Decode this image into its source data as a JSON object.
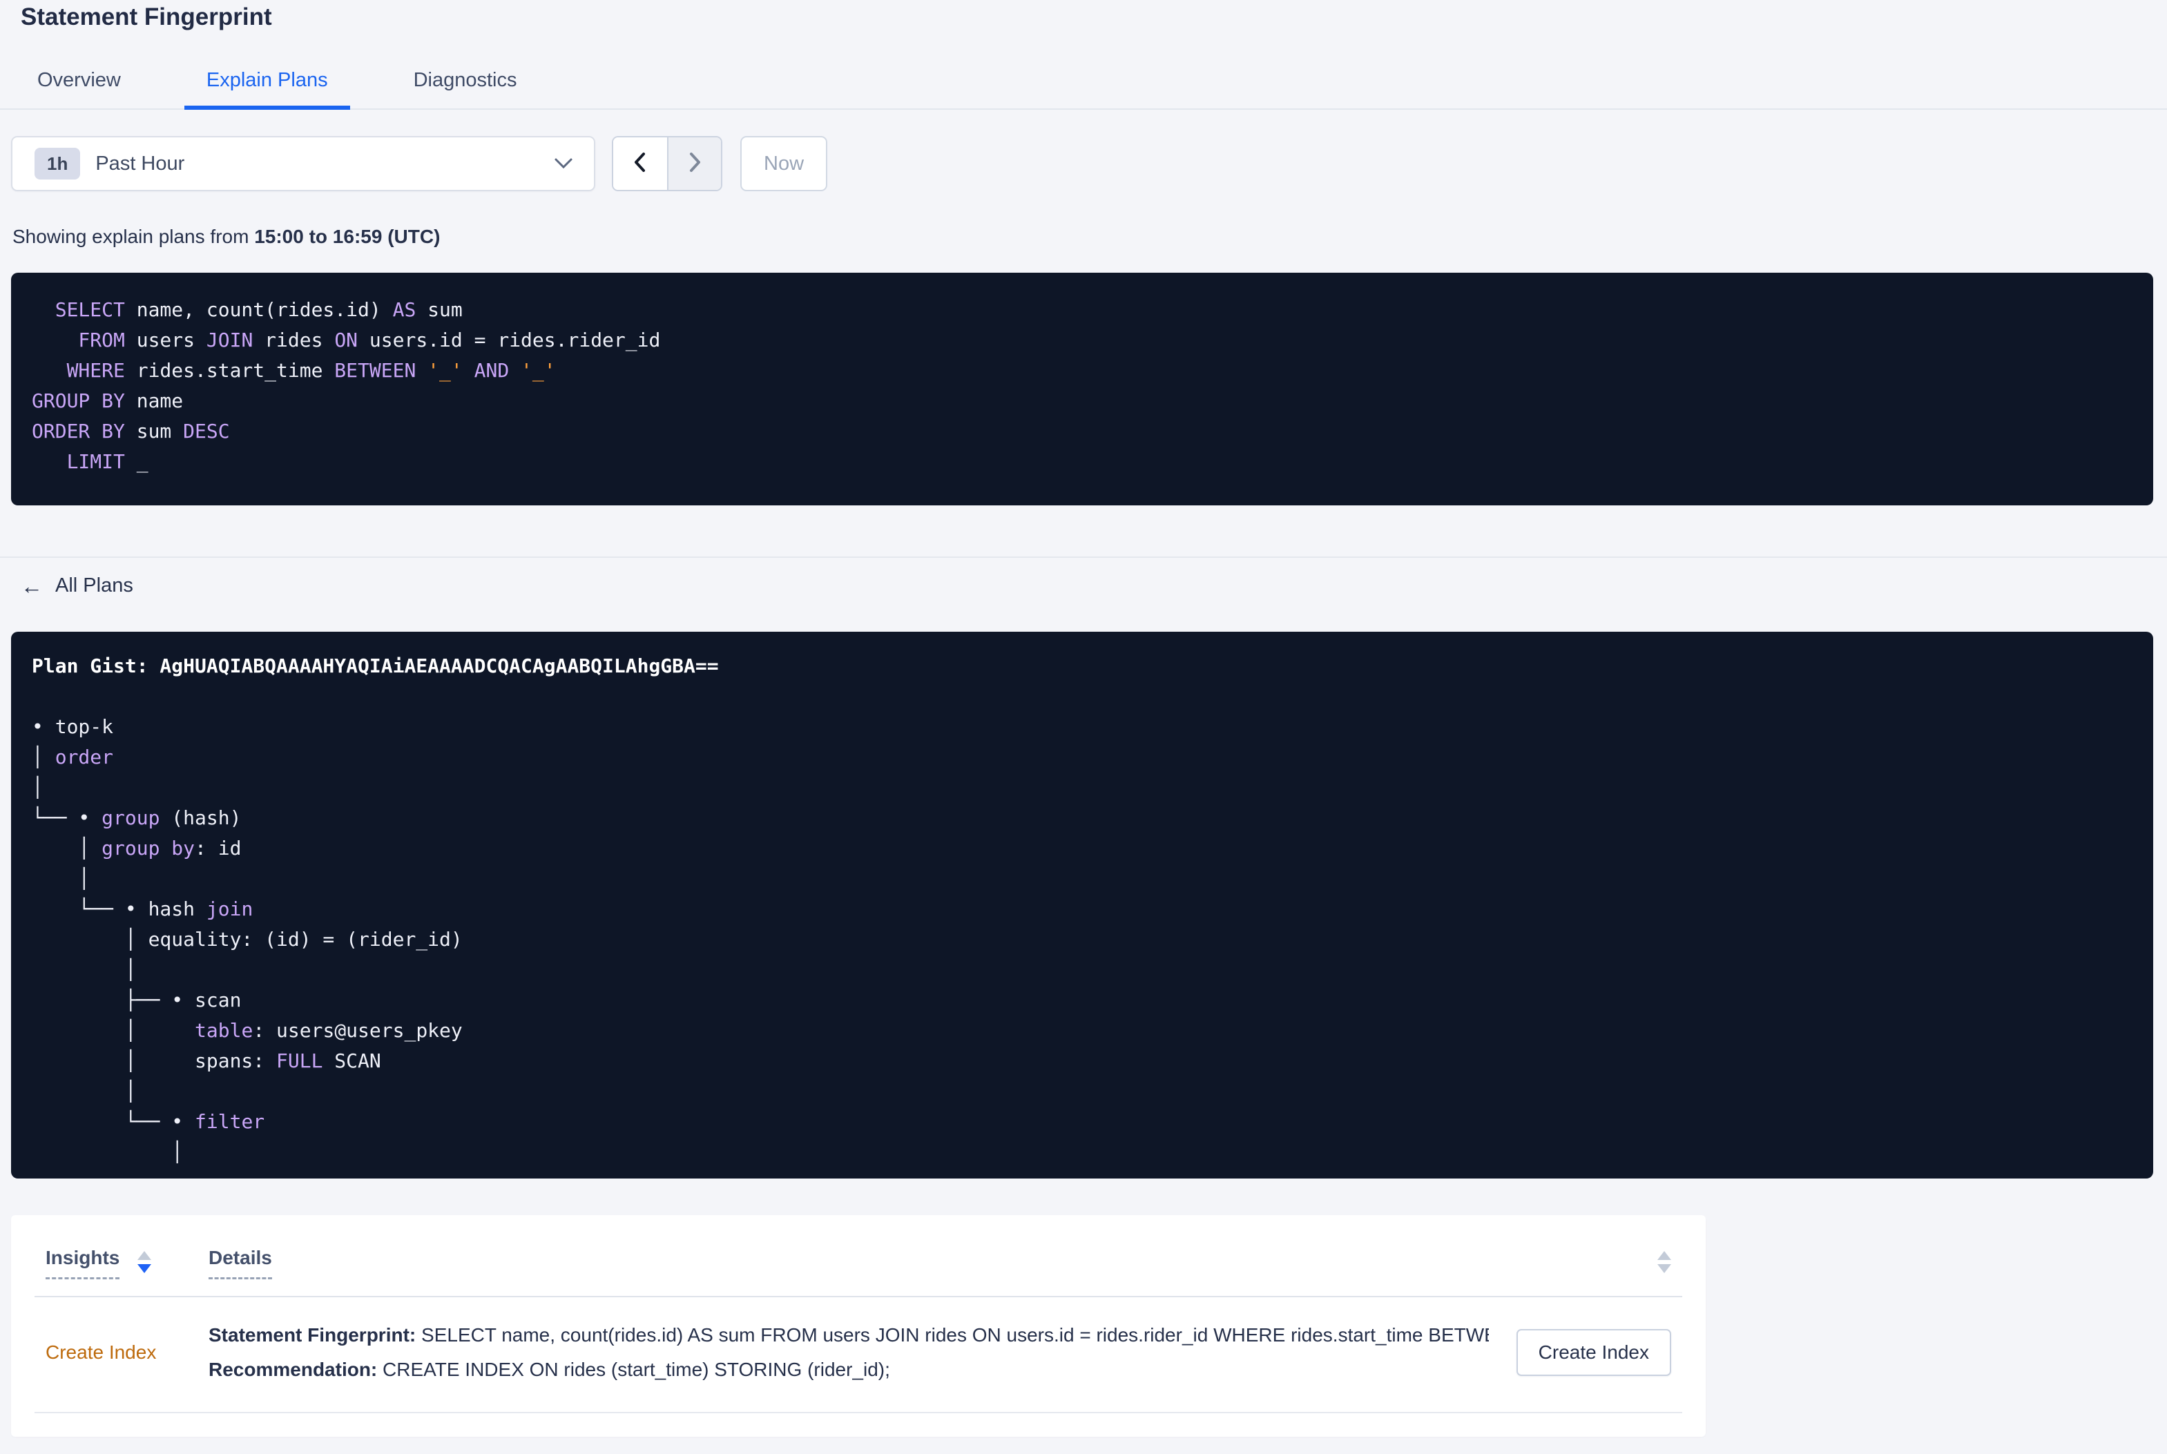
{
  "page": {
    "title": "Statement Fingerprint"
  },
  "tabs": [
    {
      "label": "Overview",
      "active": false
    },
    {
      "label": "Explain Plans",
      "active": true
    },
    {
      "label": "Diagnostics",
      "active": false
    }
  ],
  "time_selector": {
    "badge": "1h",
    "label": "Past Hour",
    "now_label": "Now"
  },
  "showing": {
    "prefix": "Showing explain plans from ",
    "range": "15:00 to 16:59 (UTC)"
  },
  "sql": {
    "lines": [
      [
        {
          "c": "kw",
          "t": "  SELECT"
        },
        {
          "c": "tx",
          "t": " name, count(rides.id) "
        },
        {
          "c": "kw",
          "t": "AS"
        },
        {
          "c": "tx",
          "t": " sum"
        }
      ],
      [
        {
          "c": "kw",
          "t": "    FROM"
        },
        {
          "c": "tx",
          "t": " users "
        },
        {
          "c": "kw",
          "t": "JOIN"
        },
        {
          "c": "tx",
          "t": " rides "
        },
        {
          "c": "kw",
          "t": "ON"
        },
        {
          "c": "tx",
          "t": " users.id = rides.rider_id"
        }
      ],
      [
        {
          "c": "kw",
          "t": "   WHERE"
        },
        {
          "c": "tx",
          "t": " rides.start_time "
        },
        {
          "c": "kw",
          "t": "BETWEEN"
        },
        {
          "c": "str",
          "t": " '_'"
        },
        {
          "c": "kw",
          "t": " AND"
        },
        {
          "c": "str",
          "t": " '_'"
        }
      ],
      [
        {
          "c": "kw",
          "t": "GROUP BY"
        },
        {
          "c": "tx",
          "t": " name"
        }
      ],
      [
        {
          "c": "kw",
          "t": "ORDER BY"
        },
        {
          "c": "tx",
          "t": " sum "
        },
        {
          "c": "kw",
          "t": "DESC"
        }
      ],
      [
        {
          "c": "kw",
          "t": "   LIMIT"
        },
        {
          "c": "tx",
          "t": " _"
        }
      ]
    ]
  },
  "all_plans": {
    "label": "All Plans",
    "arrow": "←"
  },
  "plan": {
    "gist": "Plan Gist: AgHUAQIABQAAAAHYAQIAiAEAAAADCQACAgAABQILAhgGBA==",
    "lines": [
      [
        {
          "c": "bold",
          "t": "Plan Gist: AgHUAQIABQAAAAHYAQIAiAEAAAADCQACAgAABQILAhgGBA=="
        }
      ],
      [],
      [
        {
          "c": "tx",
          "t": "• top-k"
        }
      ],
      [
        {
          "c": "tx",
          "t": "│ "
        },
        {
          "c": "kw",
          "t": "order"
        }
      ],
      [
        {
          "c": "tx",
          "t": "│"
        }
      ],
      [
        {
          "c": "tx",
          "t": "└── • "
        },
        {
          "c": "kw",
          "t": "group"
        },
        {
          "c": "tx",
          "t": " (hash)"
        }
      ],
      [
        {
          "c": "tx",
          "t": "    │ "
        },
        {
          "c": "kw",
          "t": "group by"
        },
        {
          "c": "tx",
          "t": ": id"
        }
      ],
      [
        {
          "c": "tx",
          "t": "    │"
        }
      ],
      [
        {
          "c": "tx",
          "t": "    └── • hash "
        },
        {
          "c": "kw",
          "t": "join"
        }
      ],
      [
        {
          "c": "tx",
          "t": "        │ equality: (id) = (rider_id)"
        }
      ],
      [
        {
          "c": "tx",
          "t": "        │"
        }
      ],
      [
        {
          "c": "tx",
          "t": "        ├── • scan"
        }
      ],
      [
        {
          "c": "tx",
          "t": "        │     "
        },
        {
          "c": "kw",
          "t": "table"
        },
        {
          "c": "tx",
          "t": ": users@users_pkey"
        }
      ],
      [
        {
          "c": "tx",
          "t": "        │     spans: "
        },
        {
          "c": "kw",
          "t": "FULL"
        },
        {
          "c": "tx",
          "t": " SCAN"
        }
      ],
      [
        {
          "c": "tx",
          "t": "        │"
        }
      ],
      [
        {
          "c": "tx",
          "t": "        └── • "
        },
        {
          "c": "kw",
          "t": "filter"
        }
      ],
      [
        {
          "c": "tx",
          "t": "            │"
        }
      ]
    ]
  },
  "insights_table": {
    "headers": [
      {
        "label": "Insights",
        "sort": "desc"
      },
      {
        "label": "Details",
        "sort": "none"
      }
    ],
    "rows": [
      {
        "insight": "Create Index",
        "details": [
          {
            "label": "Statement Fingerprint:",
            "value": " SELECT name, count(rides.id) AS sum FROM users JOIN rides ON users.id = rides.rider_id WHERE rides.start_time BETWEEN '_…"
          },
          {
            "label": "Recommendation:",
            "value": " CREATE INDEX ON rides (start_time) STORING (rider_id);"
          }
        ],
        "action_label": "Create Index"
      }
    ]
  },
  "colors": {
    "accent_blue": "#1a64f0",
    "insight_orange": "#bd6a0c",
    "code_background": "#0e1627",
    "code_keyword": "#c9a6f7",
    "code_literal": "#ffa13c",
    "page_background": "#f4f5f9"
  }
}
